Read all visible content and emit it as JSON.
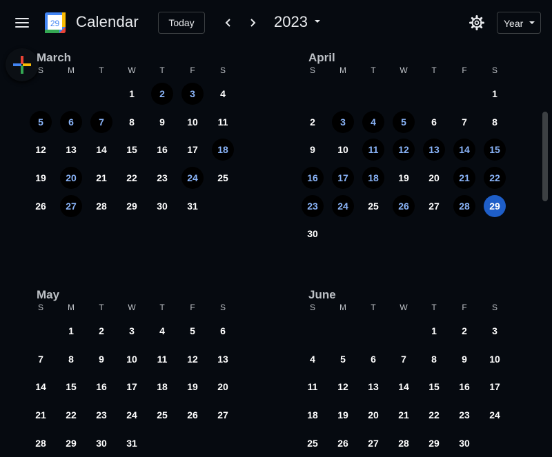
{
  "header": {
    "logo_day": "29",
    "title": "Calendar",
    "today_label": "Today",
    "year": "2023",
    "view_label": "Year"
  },
  "icons": {
    "menu": "menu-icon",
    "prev": "chevron-left-icon",
    "next": "chevron-right-icon",
    "year_dropdown": "caret-down-icon",
    "settings": "gear-icon",
    "view_dropdown": "caret-down-icon",
    "create": "plus-icon"
  },
  "colors": {
    "background": "#060a10",
    "event_day_text": "#8ab4f8",
    "selected_day_bg": "#1e5ec8",
    "logo_blue": "#4285f4",
    "logo_red": "#ea4335",
    "logo_yellow": "#fbbc04",
    "logo_green": "#34a853"
  },
  "weekdays": [
    "S",
    "M",
    "T",
    "W",
    "T",
    "F",
    "S"
  ],
  "months": [
    {
      "name": "March",
      "leading_blanks": 3,
      "days_in_month": 31,
      "event_days": [
        2,
        3,
        5,
        6,
        7,
        18,
        20,
        24,
        27
      ],
      "selected_day": null
    },
    {
      "name": "April",
      "leading_blanks": 6,
      "days_in_month": 30,
      "event_days": [
        3,
        4,
        5,
        11,
        12,
        13,
        14,
        15,
        16,
        17,
        18,
        21,
        22,
        23,
        24,
        26,
        28
      ],
      "selected_day": 29
    },
    {
      "name": "May",
      "leading_blanks": 1,
      "days_in_month": 31,
      "event_days": [],
      "selected_day": null
    },
    {
      "name": "June",
      "leading_blanks": 4,
      "days_in_month": 30,
      "event_days": [],
      "selected_day": null
    }
  ]
}
